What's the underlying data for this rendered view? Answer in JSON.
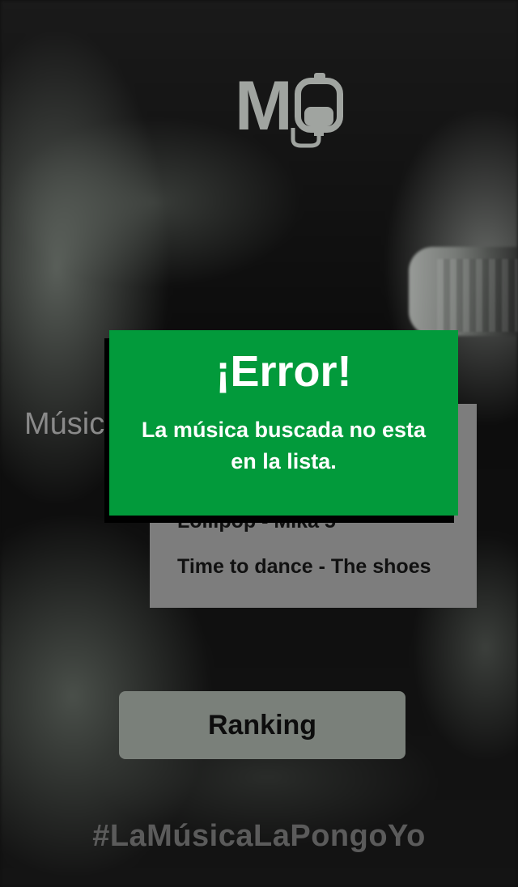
{
  "app": {
    "logo_text": "M",
    "logo_icon": "iv-bag-icon",
    "search_label": "Músic",
    "hashtag": "#LaMúsicaLaPongoYo"
  },
  "song_list": {
    "items": [
      "Lollipop - Mika 5",
      "Time to dance - The shoes"
    ]
  },
  "ranking_button": {
    "label": "Ranking"
  },
  "error_modal": {
    "title": "¡Error!",
    "message": "La música buscada no esta en la lista."
  },
  "colors": {
    "modal_green": "#029a3b",
    "button_gray": "#7a807a",
    "panel_gray": "#7d7d7d"
  }
}
